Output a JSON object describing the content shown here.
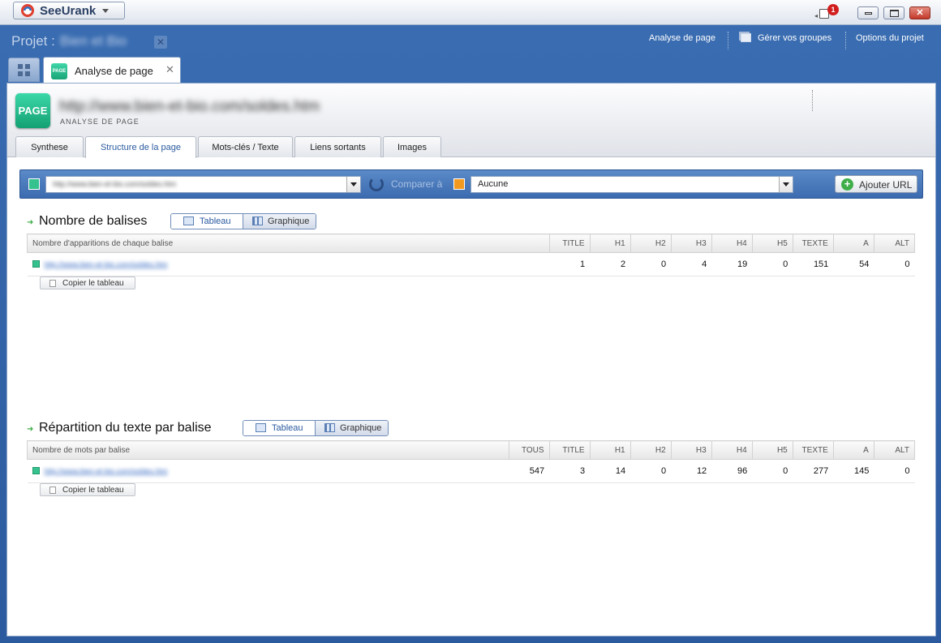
{
  "app": {
    "name": "SeeUrank",
    "notification_count": "1"
  },
  "project": {
    "label": "Projet :",
    "name": "Bien et Bio"
  },
  "top_links": [
    "Analyse de page",
    "Gérer vos groupes",
    "Options du projet"
  ],
  "doc_tab": {
    "icon_text": "PAGE",
    "label": "Analyse de page"
  },
  "page": {
    "icon_text": "PAGE",
    "url": "http://www.bien-et-bio.com/soldes.htm",
    "subtitle": "ANALYSE DE PAGE"
  },
  "subtabs": [
    "Synthese",
    "Structure de la page",
    "Mots-clés / Texte",
    "Liens sortants",
    "Images"
  ],
  "urlbar": {
    "url_value": "http://www.bien-et-bio.com/soldes.htm",
    "compare_label": "Comparer à",
    "compare_value": "Aucune",
    "add_button": "Ajouter URL"
  },
  "colors": {
    "accent_green": "#35c28f",
    "compare_orange": "#f29a1f",
    "header_blue": "#3a6db2"
  },
  "section1": {
    "title": "Nombre de balises",
    "toggle_table": "Tableau",
    "toggle_chart": "Graphique",
    "headers": [
      "Nombre d'apparitions de chaque balise",
      "TITLE",
      "H1",
      "H2",
      "H3",
      "H4",
      "H5",
      "TEXTE",
      "A",
      "ALT"
    ],
    "rows": [
      {
        "url": "http://www.bien-et-bio.com/soldes.htm",
        "values": [
          "1",
          "2",
          "0",
          "4",
          "19",
          "0",
          "151",
          "54",
          "0"
        ]
      }
    ],
    "copy_button": "Copier le tableau"
  },
  "section2": {
    "title": "Répartition du texte par balise",
    "toggle_table": "Tableau",
    "toggle_chart": "Graphique",
    "headers": [
      "Nombre de mots par balise",
      "TOUS",
      "TITLE",
      "H1",
      "H2",
      "H3",
      "H4",
      "H5",
      "TEXTE",
      "A",
      "ALT"
    ],
    "rows": [
      {
        "url": "http://www.bien-et-bio.com/soldes.htm",
        "values": [
          "547",
          "3",
          "14",
          "0",
          "12",
          "96",
          "0",
          "277",
          "145",
          "0"
        ]
      }
    ],
    "copy_button": "Copier le tableau"
  }
}
